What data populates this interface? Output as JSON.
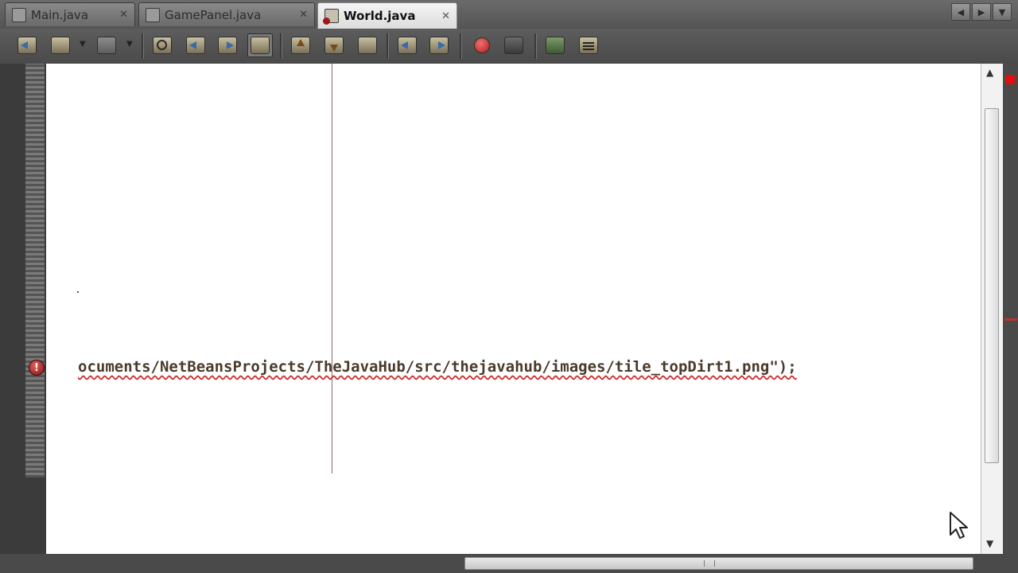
{
  "tabs": [
    {
      "label": "Main.java",
      "active": false
    },
    {
      "label": "GamePanel.java",
      "active": false
    },
    {
      "label": "World.java",
      "active": true
    }
  ],
  "tab_close_glyph": "✕",
  "window_controls": [
    "◀",
    "▶",
    "▼"
  ],
  "toolbar_icons": [
    "back-history-icon",
    "forward-history-icon",
    "last-edit-icon",
    "find-selection-icon",
    "find-previous-icon",
    "find-next-icon",
    "toggle-highlight-icon",
    "previous-bookmark-icon",
    "next-bookmark-icon",
    "toggle-bookmark-icon",
    "shift-left-icon",
    "shift-right-icon",
    "start-macro-icon",
    "stop-macro-icon",
    "comment-icon",
    "uncomment-icon"
  ],
  "editor": {
    "code_line": "ocuments/NetBeansProjects/TheJavaHub/src/thejavahub/images/tile_topDirt1.png\");",
    "error_glyph": "!"
  },
  "colors": {
    "error": "#e01010",
    "squiggle": "#d03030",
    "active_tab": "#f0f0f0",
    "toolbar": "#555555"
  }
}
